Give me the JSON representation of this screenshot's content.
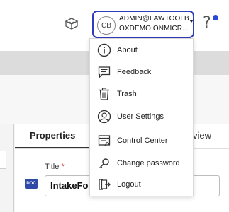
{
  "header": {
    "account": {
      "initials": "CB",
      "email": "ADMIN@LAWTOOLBOXDEMO.ONMICR..."
    },
    "help_glyph": "?",
    "icons": [
      "box-tray-icon",
      "help-icon",
      "notification-dot-icon",
      "chevron-down-icon"
    ]
  },
  "user_menu": {
    "items": [
      {
        "label": "About",
        "icon": "info-icon"
      },
      {
        "label": "Feedback",
        "icon": "feedback-icon"
      },
      {
        "label": "Trash",
        "icon": "trash-icon"
      },
      {
        "label": "User Settings",
        "icon": "user-icon"
      },
      {
        "label": "Control Center",
        "icon": "control-center-icon"
      },
      {
        "label": "Change password",
        "icon": "key-icon"
      },
      {
        "label": "Logout",
        "icon": "logout-icon"
      }
    ]
  },
  "properties_panel": {
    "tabs": [
      {
        "label": "Properties",
        "active": true
      },
      {
        "label": "view",
        "active": false
      }
    ],
    "title_field": {
      "label": "Title",
      "required_mark": "*",
      "value": "IntakeFor",
      "doc_badge": "DOC"
    }
  },
  "colors": {
    "accent": "#2f3dba",
    "notification": "#2a48d6",
    "required": "#c62828",
    "grey_band": "#dcdcdc"
  }
}
